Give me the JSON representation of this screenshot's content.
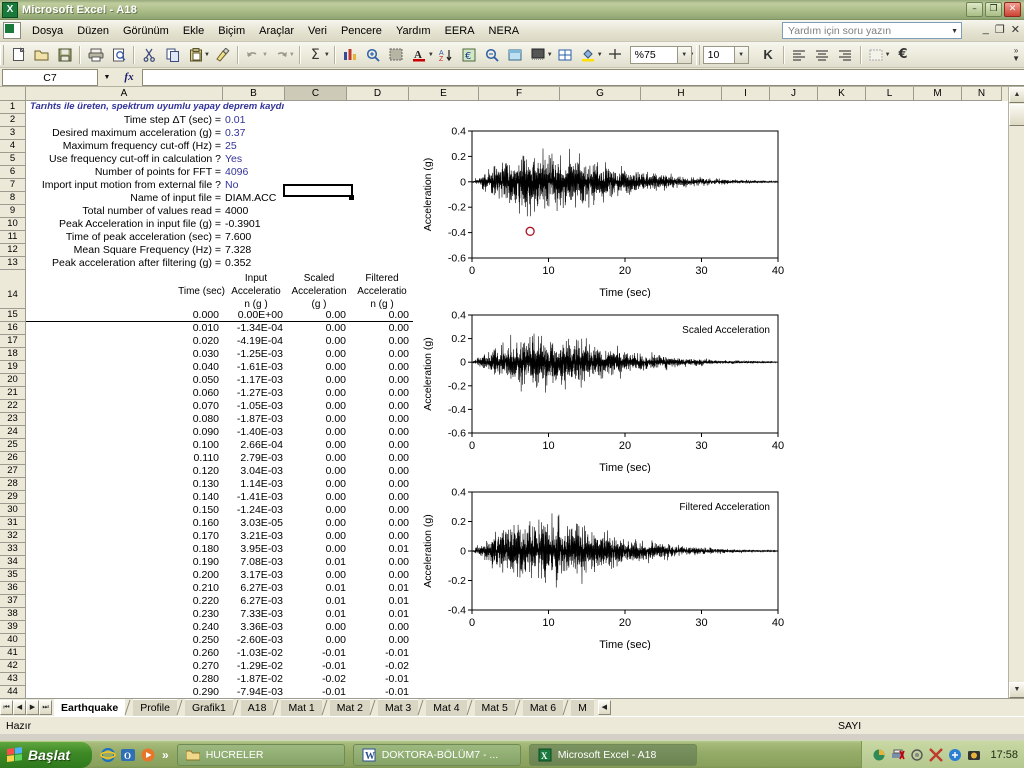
{
  "window": {
    "title": "Microsoft Excel - A18",
    "app_icon": "excel-icon",
    "minimize": "–",
    "restore": "❐",
    "close": "✕"
  },
  "menubar": {
    "items": [
      "Dosya",
      "Düzen",
      "Görünüm",
      "Ekle",
      "Biçim",
      "Araçlar",
      "Veri",
      "Pencere",
      "Yardım",
      "EERA",
      "NERA"
    ],
    "ask_placeholder": "Yardım için soru yazın",
    "inner_minimize": "_",
    "inner_restore": "❐",
    "inner_close": "✕"
  },
  "toolbar": {
    "zoom_value": "%75",
    "font_size_value": "10",
    "bold_label": "K",
    "icons": [
      "new-icon",
      "open-icon",
      "save-icon",
      "print-icon",
      "print-preview-icon",
      "cut-icon",
      "copy-icon",
      "paste-icon",
      "format-painter-icon",
      "undo-icon",
      "redo-icon",
      "autosum-icon",
      "chart-wizard-icon",
      "zoom-in-icon",
      "drawing-icon",
      "font-color-icon",
      "sort-asc-icon",
      "euro-icon",
      "zoom-out-icon",
      "borders-icon",
      "fill-color-icon",
      "merge-icon",
      "align-left-icon",
      "align-center-icon",
      "align-right-icon"
    ]
  },
  "formula_bar": {
    "name_box": "C7",
    "fx_label": "fx",
    "formula": ""
  },
  "grid": {
    "columns": [
      "A",
      "B",
      "C",
      "D",
      "E",
      "F",
      "G",
      "H",
      "I",
      "J",
      "K",
      "L",
      "M",
      "N"
    ],
    "selected_column": "C",
    "row_numbers": [
      1,
      2,
      3,
      4,
      5,
      6,
      7,
      8,
      9,
      10,
      11,
      12,
      13,
      14,
      15,
      16,
      17,
      18,
      19,
      20,
      21,
      22,
      23,
      24,
      25,
      26,
      27,
      28,
      29,
      30,
      31,
      32,
      33,
      34,
      35,
      36,
      37,
      38,
      39,
      40,
      41,
      42,
      43,
      44
    ],
    "title_row": "Tarıhts ile üreten, spektrum uyumlu yapay deprem kaydı",
    "parameters": [
      {
        "row": 2,
        "label": "Time step ΔT (sec) =",
        "value": "0.01"
      },
      {
        "row": 3,
        "label": "Desired maximum acceleration (g) =",
        "value": "0.37"
      },
      {
        "row": 4,
        "label": "Maximum frequency cut-off (Hz) =",
        "value": "25"
      },
      {
        "row": 5,
        "label": "Use frequency cut-off in calculation ?",
        "value": "Yes"
      },
      {
        "row": 6,
        "label": "Number of points for FFT =",
        "value": "4096"
      },
      {
        "row": 7,
        "label": "Import input motion from external file ?",
        "value": "No"
      },
      {
        "row": 8,
        "label": "Name of input file =",
        "value": "DIAM.ACC",
        "black": true
      },
      {
        "row": 9,
        "label": "Total number of values read =",
        "value": "4000",
        "black": true
      },
      {
        "row": 10,
        "label": "Peak Acceleration in input file (g) =",
        "value": "-0.3901",
        "black": true
      },
      {
        "row": 11,
        "label": "Time of peak acceleration (sec) =",
        "value": "7.600",
        "black": true
      },
      {
        "row": 12,
        "label": "Mean Square Frequency (Hz) =",
        "value": "7.328",
        "black": true
      },
      {
        "row": 13,
        "label": "Peak acceleration after filtering (g) =",
        "value": "0.352",
        "black": true
      }
    ],
    "table_headers": [
      "Time (sec)",
      "Input Acceleration (g )",
      "Scaled Acceleration (g )",
      "Filtered Acceleration (g )"
    ],
    "table_headers_lines": [
      {
        "l1": "",
        "l2": "Time (sec)",
        "l3": ""
      },
      {
        "l1": "Input",
        "l2": "Acceleratio",
        "l3": "n (g )"
      },
      {
        "l1": "Scaled",
        "l2": "Acceleration",
        "l3": "(g )"
      },
      {
        "l1": "Filtered",
        "l2": "Acceleratio",
        "l3": "n (g )"
      }
    ],
    "table_rows": [
      {
        "row": 15,
        "time": "0.000",
        "input": "0.00E+00",
        "scaled": "0.00",
        "filtered": "0.00"
      },
      {
        "row": 16,
        "time": "0.010",
        "input": "-1.34E-04",
        "scaled": "0.00",
        "filtered": "0.00"
      },
      {
        "row": 17,
        "time": "0.020",
        "input": "-4.19E-04",
        "scaled": "0.00",
        "filtered": "0.00"
      },
      {
        "row": 18,
        "time": "0.030",
        "input": "-1.25E-03",
        "scaled": "0.00",
        "filtered": "0.00"
      },
      {
        "row": 19,
        "time": "0.040",
        "input": "-1.61E-03",
        "scaled": "0.00",
        "filtered": "0.00"
      },
      {
        "row": 20,
        "time": "0.050",
        "input": "-1.17E-03",
        "scaled": "0.00",
        "filtered": "0.00"
      },
      {
        "row": 21,
        "time": "0.060",
        "input": "-1.27E-03",
        "scaled": "0.00",
        "filtered": "0.00"
      },
      {
        "row": 22,
        "time": "0.070",
        "input": "-1.05E-03",
        "scaled": "0.00",
        "filtered": "0.00"
      },
      {
        "row": 23,
        "time": "0.080",
        "input": "-1.87E-03",
        "scaled": "0.00",
        "filtered": "0.00"
      },
      {
        "row": 24,
        "time": "0.090",
        "input": "-1.40E-03",
        "scaled": "0.00",
        "filtered": "0.00"
      },
      {
        "row": 25,
        "time": "0.100",
        "input": "2.66E-04",
        "scaled": "0.00",
        "filtered": "0.00"
      },
      {
        "row": 26,
        "time": "0.110",
        "input": "2.79E-03",
        "scaled": "0.00",
        "filtered": "0.00"
      },
      {
        "row": 27,
        "time": "0.120",
        "input": "3.04E-03",
        "scaled": "0.00",
        "filtered": "0.00"
      },
      {
        "row": 28,
        "time": "0.130",
        "input": "1.14E-03",
        "scaled": "0.00",
        "filtered": "0.00"
      },
      {
        "row": 29,
        "time": "0.140",
        "input": "-1.41E-03",
        "scaled": "0.00",
        "filtered": "0.00"
      },
      {
        "row": 30,
        "time": "0.150",
        "input": "-1.24E-03",
        "scaled": "0.00",
        "filtered": "0.00"
      },
      {
        "row": 31,
        "time": "0.160",
        "input": "3.03E-05",
        "scaled": "0.00",
        "filtered": "0.00"
      },
      {
        "row": 32,
        "time": "0.170",
        "input": "3.21E-03",
        "scaled": "0.00",
        "filtered": "0.00"
      },
      {
        "row": 33,
        "time": "0.180",
        "input": "3.95E-03",
        "scaled": "0.00",
        "filtered": "0.01"
      },
      {
        "row": 34,
        "time": "0.190",
        "input": "7.08E-03",
        "scaled": "0.01",
        "filtered": "0.00"
      },
      {
        "row": 35,
        "time": "0.200",
        "input": "3.17E-03",
        "scaled": "0.00",
        "filtered": "0.00"
      },
      {
        "row": 36,
        "time": "0.210",
        "input": "6.27E-03",
        "scaled": "0.01",
        "filtered": "0.01"
      },
      {
        "row": 37,
        "time": "0.220",
        "input": "6.27E-03",
        "scaled": "0.01",
        "filtered": "0.01"
      },
      {
        "row": 38,
        "time": "0.230",
        "input": "7.33E-03",
        "scaled": "0.01",
        "filtered": "0.01"
      },
      {
        "row": 39,
        "time": "0.240",
        "input": "3.36E-03",
        "scaled": "0.00",
        "filtered": "0.00"
      },
      {
        "row": 40,
        "time": "0.250",
        "input": "-2.60E-03",
        "scaled": "0.00",
        "filtered": "0.00"
      },
      {
        "row": 41,
        "time": "0.260",
        "input": "-1.03E-02",
        "scaled": "-0.01",
        "filtered": "-0.01"
      },
      {
        "row": 42,
        "time": "0.270",
        "input": "-1.29E-02",
        "scaled": "-0.01",
        "filtered": "-0.02"
      },
      {
        "row": 43,
        "time": "0.280",
        "input": "-1.87E-02",
        "scaled": "-0.02",
        "filtered": "-0.01"
      },
      {
        "row": 44,
        "time": "0.290",
        "input": "-7.94E-03",
        "scaled": "-0.01",
        "filtered": "-0.01"
      }
    ]
  },
  "chart_data": [
    {
      "type": "line",
      "name": "input-acceleration-chart",
      "title": "",
      "annotation": "",
      "xlabel": "Time (sec)",
      "ylabel": "Acceleration (g)",
      "xlim": [
        0,
        40
      ],
      "ylim": [
        -0.6,
        0.4
      ],
      "xticks": [
        0,
        10,
        20,
        30,
        40
      ],
      "yticks": [
        -0.6,
        -0.4,
        -0.2,
        0,
        0.2,
        0.4
      ],
      "grid": false,
      "legend": "none",
      "marker": {
        "label": "peak-marker",
        "x": 7.6,
        "y": -0.39,
        "color": "#aa1122",
        "shape": "circle"
      },
      "envelope": [
        {
          "t": 0,
          "a": 0.0
        },
        {
          "t": 1,
          "a": 0.07
        },
        {
          "t": 2,
          "a": 0.14
        },
        {
          "t": 3,
          "a": 0.2
        },
        {
          "t": 4,
          "a": 0.24
        },
        {
          "t": 5,
          "a": 0.28
        },
        {
          "t": 6,
          "a": 0.35
        },
        {
          "t": 7,
          "a": 0.33
        },
        {
          "t": 8,
          "a": 0.39
        },
        {
          "t": 9,
          "a": 0.33
        },
        {
          "t": 10,
          "a": 0.31
        },
        {
          "t": 12,
          "a": 0.29
        },
        {
          "t": 14,
          "a": 0.32
        },
        {
          "t": 16,
          "a": 0.23
        },
        {
          "t": 18,
          "a": 0.19
        },
        {
          "t": 20,
          "a": 0.15
        },
        {
          "t": 24,
          "a": 0.1
        },
        {
          "t": 28,
          "a": 0.06
        },
        {
          "t": 32,
          "a": 0.035
        },
        {
          "t": 36,
          "a": 0.02
        },
        {
          "t": 40,
          "a": 0.005
        }
      ]
    },
    {
      "type": "line",
      "name": "scaled-acceleration-chart",
      "title": "",
      "annotation": "Scaled Acceleration",
      "xlabel": "Time (sec)",
      "ylabel": "Acceleration (g)",
      "xlim": [
        0,
        40
      ],
      "ylim": [
        -0.6,
        0.4
      ],
      "xticks": [
        0,
        10,
        20,
        30,
        40
      ],
      "yticks": [
        -0.6,
        -0.4,
        -0.2,
        0,
        0.2,
        0.4
      ],
      "grid": false,
      "legend": "none",
      "envelope": [
        {
          "t": 0,
          "a": 0.0
        },
        {
          "t": 1,
          "a": 0.06
        },
        {
          "t": 2,
          "a": 0.13
        },
        {
          "t": 3,
          "a": 0.19
        },
        {
          "t": 4,
          "a": 0.23
        },
        {
          "t": 5,
          "a": 0.27
        },
        {
          "t": 6,
          "a": 0.34
        },
        {
          "t": 7,
          "a": 0.31
        },
        {
          "t": 8,
          "a": 0.37
        },
        {
          "t": 9,
          "a": 0.31
        },
        {
          "t": 10,
          "a": 0.3
        },
        {
          "t": 12,
          "a": 0.28
        },
        {
          "t": 14,
          "a": 0.3
        },
        {
          "t": 16,
          "a": 0.22
        },
        {
          "t": 18,
          "a": 0.18
        },
        {
          "t": 20,
          "a": 0.14
        },
        {
          "t": 24,
          "a": 0.09
        },
        {
          "t": 28,
          "a": 0.055
        },
        {
          "t": 32,
          "a": 0.03
        },
        {
          "t": 36,
          "a": 0.018
        },
        {
          "t": 40,
          "a": 0.004
        }
      ]
    },
    {
      "type": "line",
      "name": "filtered-acceleration-chart",
      "title": "",
      "annotation": "Filtered Acceleration",
      "xlabel": "Time (sec)",
      "ylabel": "Acceleration (g)",
      "xlim": [
        0,
        40
      ],
      "ylim": [
        -0.4,
        0.4
      ],
      "xticks": [
        0,
        10,
        20,
        30,
        40
      ],
      "yticks": [
        -0.4,
        -0.2,
        0,
        0.2,
        0.4
      ],
      "grid": false,
      "legend": "none",
      "envelope": [
        {
          "t": 0,
          "a": 0.0
        },
        {
          "t": 1,
          "a": 0.06
        },
        {
          "t": 2,
          "a": 0.13
        },
        {
          "t": 3,
          "a": 0.19
        },
        {
          "t": 4,
          "a": 0.22
        },
        {
          "t": 5,
          "a": 0.26
        },
        {
          "t": 6,
          "a": 0.33
        },
        {
          "t": 7,
          "a": 0.3
        },
        {
          "t": 8,
          "a": 0.36
        },
        {
          "t": 9,
          "a": 0.31
        },
        {
          "t": 10,
          "a": 0.3
        },
        {
          "t": 12,
          "a": 0.27
        },
        {
          "t": 14,
          "a": 0.29
        },
        {
          "t": 16,
          "a": 0.21
        },
        {
          "t": 18,
          "a": 0.17
        },
        {
          "t": 20,
          "a": 0.14
        },
        {
          "t": 24,
          "a": 0.085
        },
        {
          "t": 28,
          "a": 0.05
        },
        {
          "t": 32,
          "a": 0.028
        },
        {
          "t": 36,
          "a": 0.015
        },
        {
          "t": 40,
          "a": 0.004
        }
      ]
    }
  ],
  "sheet_tabs": {
    "nav": [
      "⏮",
      "◀",
      "▶",
      "⏭"
    ],
    "tabs": [
      "Earthquake",
      "Profile",
      "Grafik1",
      "A18",
      "Mat 1",
      "Mat 2",
      "Mat 3",
      "Mat 4",
      "Mat 5",
      "Mat 6",
      "M"
    ],
    "active": "Earthquake"
  },
  "status_bar": {
    "left": "Hazır",
    "mode": "SAYI"
  },
  "taskbar": {
    "start_label": "Başlat",
    "quick_launch": [
      "internet-explorer-icon",
      "outlook-icon",
      "media-player-icon"
    ],
    "quick_overflow": "»",
    "tasks": [
      {
        "label": "HUCRELER",
        "icon": "folder-icon",
        "active": false
      },
      {
        "label": "DOKTORA-BÖLÜM7 - ...",
        "icon": "word-icon",
        "active": false
      },
      {
        "label": "Microsoft Excel - A18",
        "icon": "excel-icon",
        "active": true
      }
    ],
    "tray_icons": [
      "network-icon",
      "printer-icon",
      "volume-icon",
      "antivirus-icon",
      "messenger-icon",
      "camera-icon"
    ],
    "clock": "17:58"
  },
  "colors": {
    "accent_blue": "#333399",
    "title_green": "#97a97c",
    "peak_marker": "#aa1122"
  }
}
